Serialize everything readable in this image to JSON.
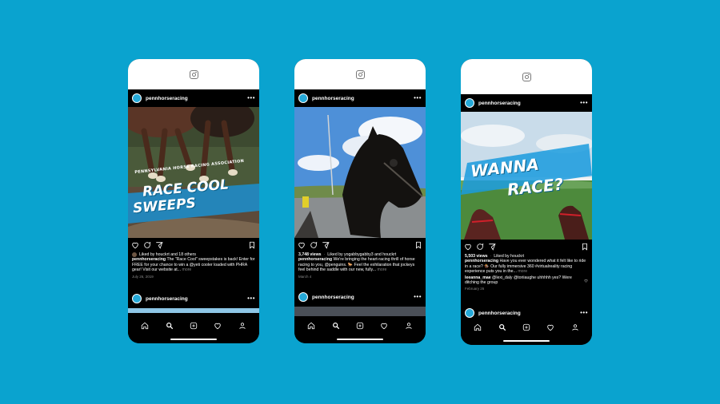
{
  "account": "pennhorseracing",
  "posts": [
    {
      "art": {
        "arc": "PENNSYLVANIA HORSE RACING ASSOCIATION",
        "line1": "RACE COOL",
        "line2": "SWEEPS"
      },
      "likes": "Liked by houckrt and 18 others",
      "caption": "The \"Race Cool\" sweepstakes is back! Enter for FREE for your chance to win a @yeti cooler loaded with PHRA gear! Visit our website at...",
      "more": "more",
      "date": "July 26, 2019"
    },
    {
      "views": "3,748 views",
      "likes": "Liked by yogabbygabby3 and houckrt",
      "caption": "We're bringing the heart-racing thrill of horse racing to you, @penguins. 🐎 Feel the exhilaration that jockeys feel behind the saddle with our new, fully...",
      "more": "more",
      "date": "March 4"
    },
    {
      "art": {
        "line1": "WANNA",
        "line2": "RACE?"
      },
      "views": "5,503 views",
      "likes": "Liked by houckrt",
      "caption": "Have you ever wondered what it felt like to ride in a race? 🏇 Our fully immersive 360 #virtualreality racing experience puts you in the...",
      "more": "more",
      "comment_user": "leeanna_mae",
      "comment": "@lexi_daly @toriiaughe uhhhhh yes? Were ditching the group",
      "date": "February 26"
    }
  ],
  "colors": {
    "background": "#0aa3cf",
    "avatar": "#26a9d8",
    "headline_fill": "#2ab2e6"
  }
}
